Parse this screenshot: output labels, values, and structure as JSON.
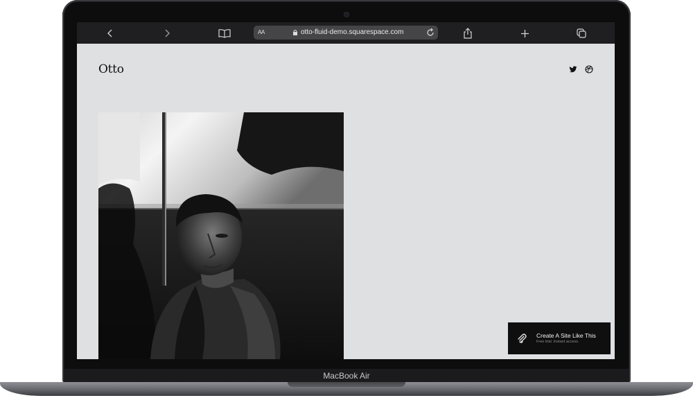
{
  "device": {
    "model_label": "MacBook Air"
  },
  "browser": {
    "text_size_label": "AA",
    "url": "otto-fluid-demo.squarespace.com",
    "icons": [
      "chevron-left-icon",
      "chevron-right-icon",
      "book-icon",
      "lock-icon",
      "reload-icon",
      "share-icon",
      "plus-icon",
      "tabs-icon"
    ]
  },
  "site": {
    "logo": "Otto",
    "social_icons": [
      "twitter-icon",
      "dribbble-icon"
    ],
    "background_color": "#dfe0e2"
  },
  "cta": {
    "title": "Create A Site Like This",
    "subtitle": "Free trial. Instant access.",
    "icon": "squarespace-logo-icon"
  }
}
